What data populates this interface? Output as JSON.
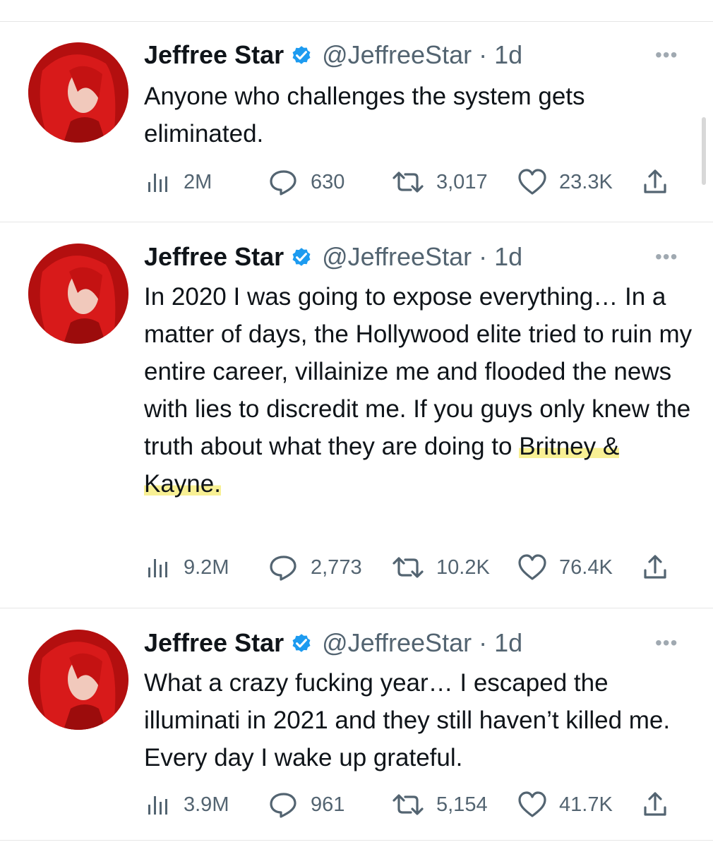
{
  "tweets": [
    {
      "name": "Jeffree Star",
      "handle": "@JeffreeStar · 1d",
      "more": "•••",
      "text_plain": "Anyone who challenges the system gets eliminated.",
      "text_pre": "",
      "text_hl": "",
      "text_post": "",
      "stats": {
        "views": "2M",
        "replies": "630",
        "retweets": "3,017",
        "likes": "23.3K"
      }
    },
    {
      "name": "Jeffree Star",
      "handle": "@JeffreeStar · 1d",
      "more": "•••",
      "text_plain": "",
      "text_pre": "In 2020 I was going to expose everything… In a matter of days, the Hollywood elite tried to ruin my entire career, villainize me and flooded the news with lies to discredit me. If you guys only knew the truth about what they are doing to ",
      "text_hl": "Britney & Kayne.",
      "text_post": "",
      "stats": {
        "views": "9.2M",
        "replies": "2,773",
        "retweets": "10.2K",
        "likes": "76.4K"
      }
    },
    {
      "name": "Jeffree Star",
      "handle": "@JeffreeStar · 1d",
      "more": "•••",
      "text_plain": "What a crazy fucking year… I escaped the illuminati in 2021 and they still haven’t killed me. Every day I wake up grateful.",
      "text_pre": "",
      "text_hl": "",
      "text_post": "",
      "stats": {
        "views": "3.9M",
        "replies": "961",
        "retweets": "5,154",
        "likes": "41.7K"
      }
    }
  ],
  "colors": {
    "verified": "#1d9bf0",
    "muted": "#536471",
    "highlight": "#f5e85a",
    "avatar_red": "#c91414"
  },
  "icons": [
    "avatar-image",
    "verified-badge-icon",
    "more-options-icon",
    "views-icon",
    "reply-icon",
    "retweet-icon",
    "like-icon",
    "share-icon"
  ]
}
